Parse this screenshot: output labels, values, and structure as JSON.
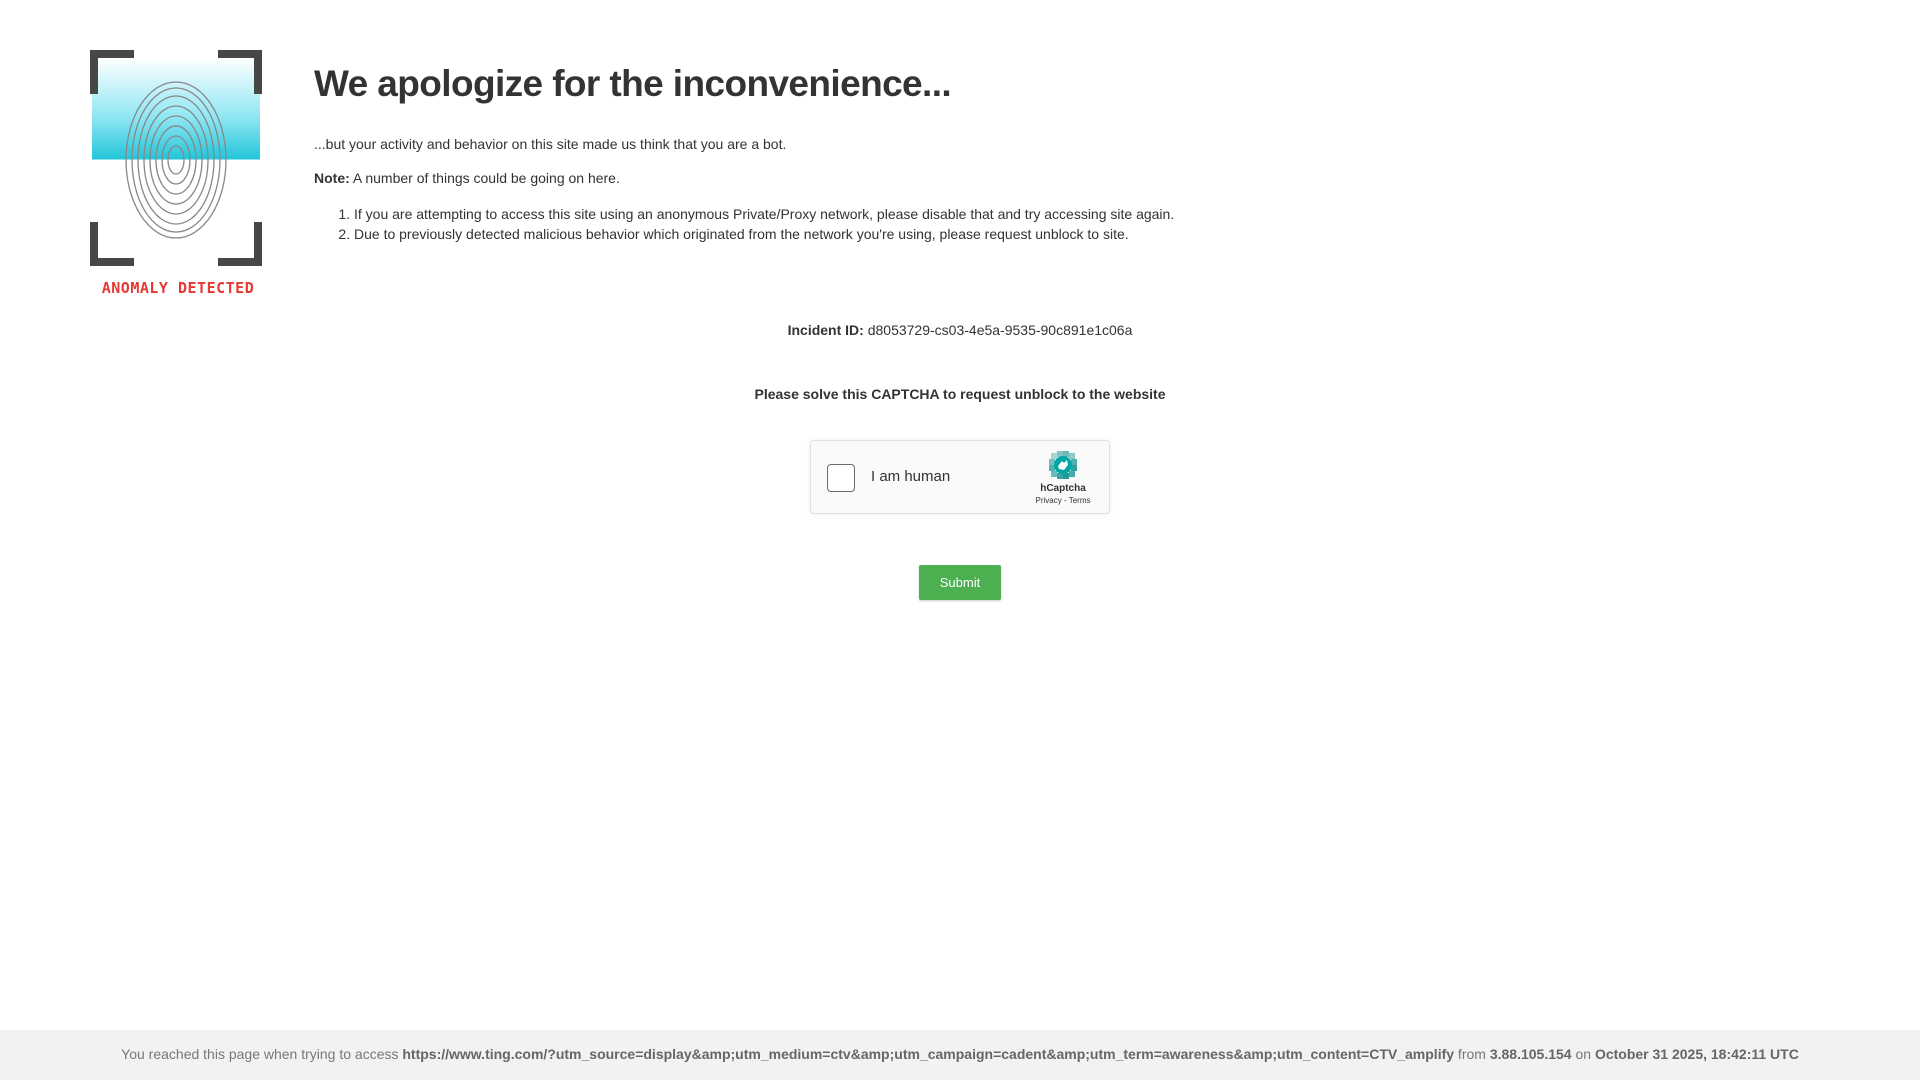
{
  "logo": {
    "caption": "ANOMALY DETECTED",
    "colors": {
      "bracket": "#474747",
      "scan": "#26c6da",
      "caption": "#e53935"
    }
  },
  "heading": "We apologize for the inconvenience...",
  "intro": "...but your activity and behavior on this site made us think that you are a bot.",
  "note": {
    "label": "Note:",
    "text": " A number of things could be going on here."
  },
  "reasons": [
    "If you are attempting to access this site using an anonymous Private/Proxy network, please disable that and try accessing site again.",
    "Due to previously detected malicious behavior which originated from the network you're using, please request unblock to site."
  ],
  "incident": {
    "label": "Incident ID:",
    "value": " d8053729-cs03-4e5a-9535-90c891e1c06a"
  },
  "captcha_prompt": "Please solve this CAPTCHA to request unblock to the website",
  "captcha": {
    "checkbox_label": "I am human",
    "brand": "hCaptcha",
    "privacy": "Privacy",
    "separator": " - ",
    "terms": "Terms",
    "checked": false
  },
  "submit_label": "Submit",
  "footer": {
    "prefix": "You reached this page when trying to access ",
    "url": "https://www.ting.com/?utm_source=display&amp;utm_medium=ctv&amp;utm_campaign=cadent&amp;utm_term=awareness&amp;utm_content=CTV_amplify",
    "from": " from ",
    "ip": "3.88.105.154",
    "on": " on ",
    "datetime": "October 31 2025, 18:42:11 UTC"
  },
  "colors": {
    "submit": "#4caf50",
    "footer_bg": "#f2f2f2"
  }
}
